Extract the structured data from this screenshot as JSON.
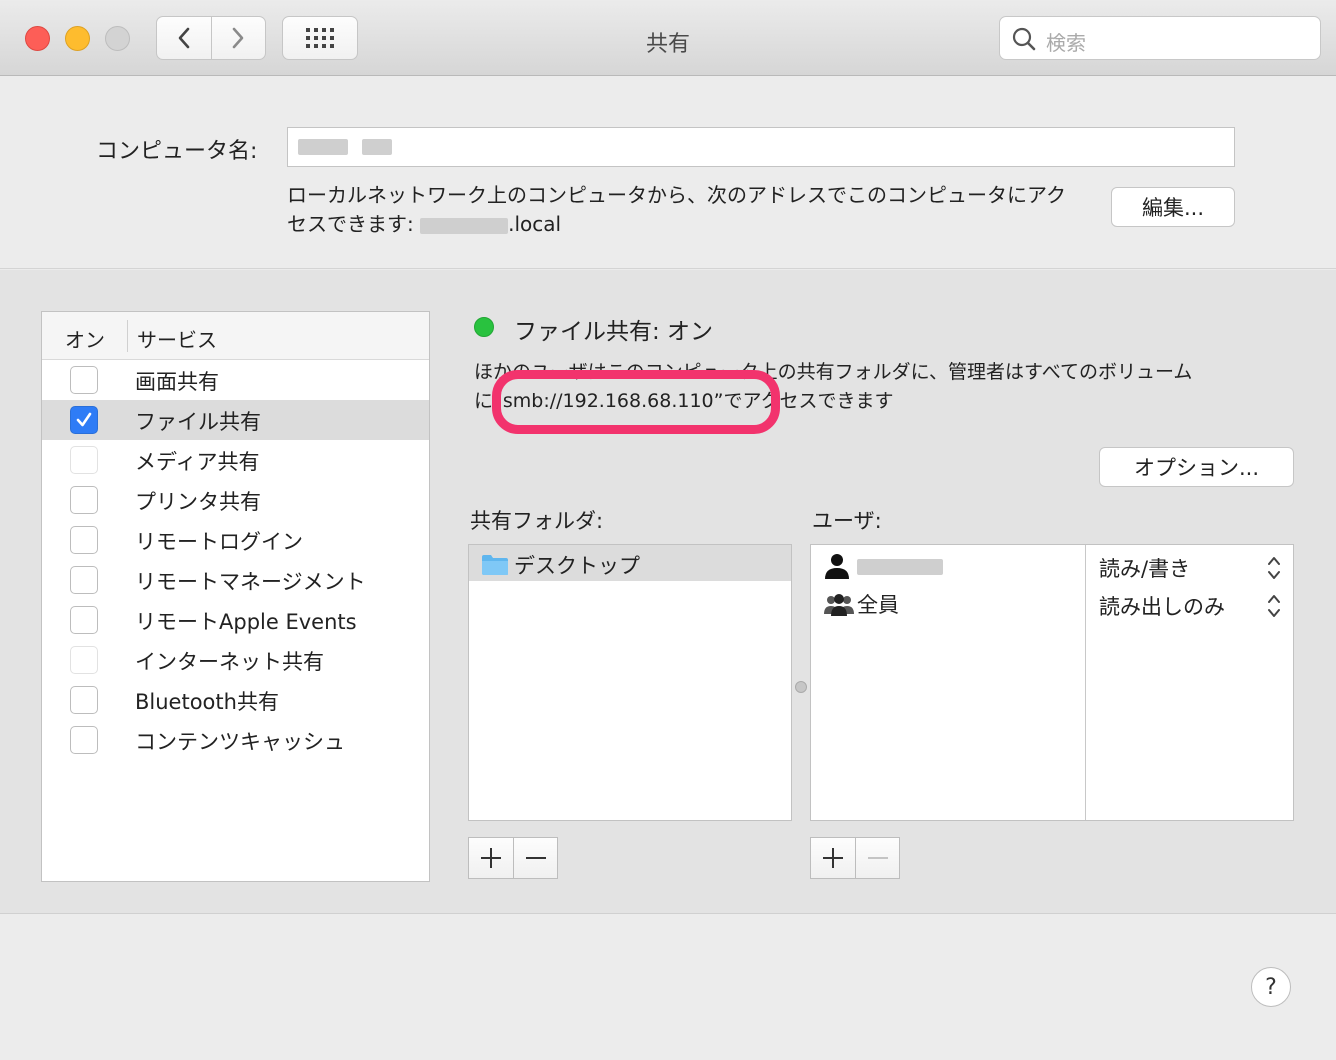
{
  "window": {
    "title": "共有",
    "search_placeholder": "検索"
  },
  "computer": {
    "name_label": "コンピュータ名:",
    "address_text_1": "ローカルネットワーク上のコンピュータから、次のアドレスでこのコンピュータにアク",
    "address_text_2_prefix": "セスできます: ",
    "address_suffix": ".local",
    "edit_button": "編集..."
  },
  "services": {
    "header_on": "オン",
    "header_service": "サービス",
    "items": [
      {
        "label": "画面共有",
        "checked": false
      },
      {
        "label": "ファイル共有",
        "checked": true
      },
      {
        "label": "メディア共有",
        "checked": false
      },
      {
        "label": "プリンタ共有",
        "checked": false
      },
      {
        "label": "リモートログイン",
        "checked": false
      },
      {
        "label": "リモートマネージメント",
        "checked": false
      },
      {
        "label": "リモートApple Events",
        "checked": false
      },
      {
        "label": "インターネット共有",
        "checked": false
      },
      {
        "label": "Bluetooth共有",
        "checked": false
      },
      {
        "label": "コンテンツキャッシュ",
        "checked": false
      }
    ]
  },
  "detail": {
    "status": "ファイル共有: オン",
    "status_color": "#29c23f",
    "desc_line1": "ほかのユーザはこのコンピュータ上の共有フォルダに、管理者はすべてのボリューム",
    "desc_line2_prefix": "に",
    "desc_address": "“smb://192.168.68.110”",
    "desc_line2_suffix": "でアクセスできます",
    "options_button": "オプション...",
    "highlight_color": "#f2336d"
  },
  "folders": {
    "label": "共有フォルダ:",
    "items": [
      {
        "label": "デスクトップ"
      }
    ]
  },
  "users": {
    "label": "ユーザ:",
    "items": [
      {
        "name": "",
        "permission": "読み/書き"
      },
      {
        "name": "全員",
        "permission": "読み出しのみ"
      }
    ]
  },
  "buttons": {
    "plus": "+",
    "minus": "−",
    "help": "?"
  }
}
